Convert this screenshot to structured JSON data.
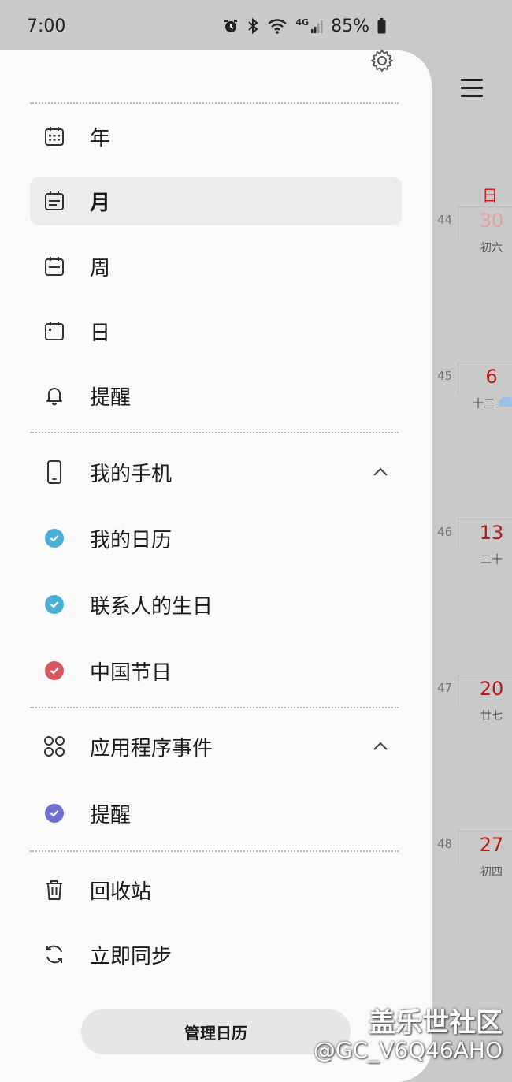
{
  "status_bar": {
    "time": "7:00",
    "network": "4G",
    "battery": "85%"
  },
  "drawer": {
    "views": [
      {
        "label": "年",
        "icon": "calendar-year-icon"
      },
      {
        "label": "月",
        "icon": "calendar-month-icon",
        "selected": true
      },
      {
        "label": "周",
        "icon": "calendar-week-icon"
      },
      {
        "label": "日",
        "icon": "calendar-day-icon"
      },
      {
        "label": "提醒",
        "icon": "bell-icon"
      }
    ],
    "my_phone": {
      "label": "我的手机",
      "calendars": [
        {
          "label": "我的日历",
          "color": "#4aaed9"
        },
        {
          "label": "联系人的生日",
          "color": "#4aaed9"
        },
        {
          "label": "中国节日",
          "color": "#d9555e"
        }
      ]
    },
    "app_events": {
      "label": "应用程序事件",
      "calendars": [
        {
          "label": "提醒",
          "color": "#6f6fcf"
        }
      ]
    },
    "trash": "回收站",
    "sync": "立即同步",
    "manage_button": "管理日历"
  },
  "calendar": {
    "day_of_week": "日",
    "weeks": [
      {
        "week": "44",
        "day": "30",
        "lunar": "初六"
      },
      {
        "week": "45",
        "day": "6",
        "lunar": "十三"
      },
      {
        "week": "46",
        "day": "13",
        "lunar": "二十"
      },
      {
        "week": "47",
        "day": "20",
        "lunar": "廿七"
      },
      {
        "week": "48",
        "day": "27",
        "lunar": "初四"
      }
    ]
  },
  "watermark": {
    "line1": "盖乐世社区",
    "line2": "@GC_V6Q46AHO"
  }
}
